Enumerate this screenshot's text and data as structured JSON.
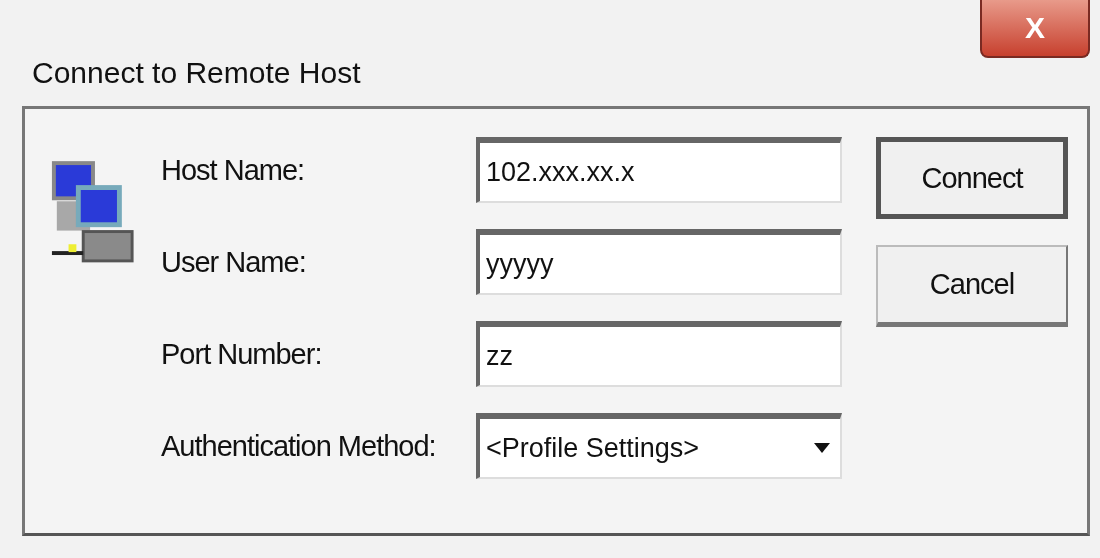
{
  "window": {
    "title": "Connect to Remote Host",
    "close": "X"
  },
  "fields": [
    {
      "label": "Host Name:",
      "kind": "text",
      "value": "102.xxx.xx.x"
    },
    {
      "label": "User Name:",
      "kind": "text",
      "value": "yyyyy"
    },
    {
      "label": "Port Number:",
      "kind": "text",
      "value": "zz"
    },
    {
      "label": "Authentication Method:",
      "kind": "dropdown",
      "value": "<Profile Settings>"
    }
  ],
  "buttons": [
    {
      "label": "Connect",
      "default": true
    },
    {
      "label": "Cancel",
      "default": false
    }
  ]
}
